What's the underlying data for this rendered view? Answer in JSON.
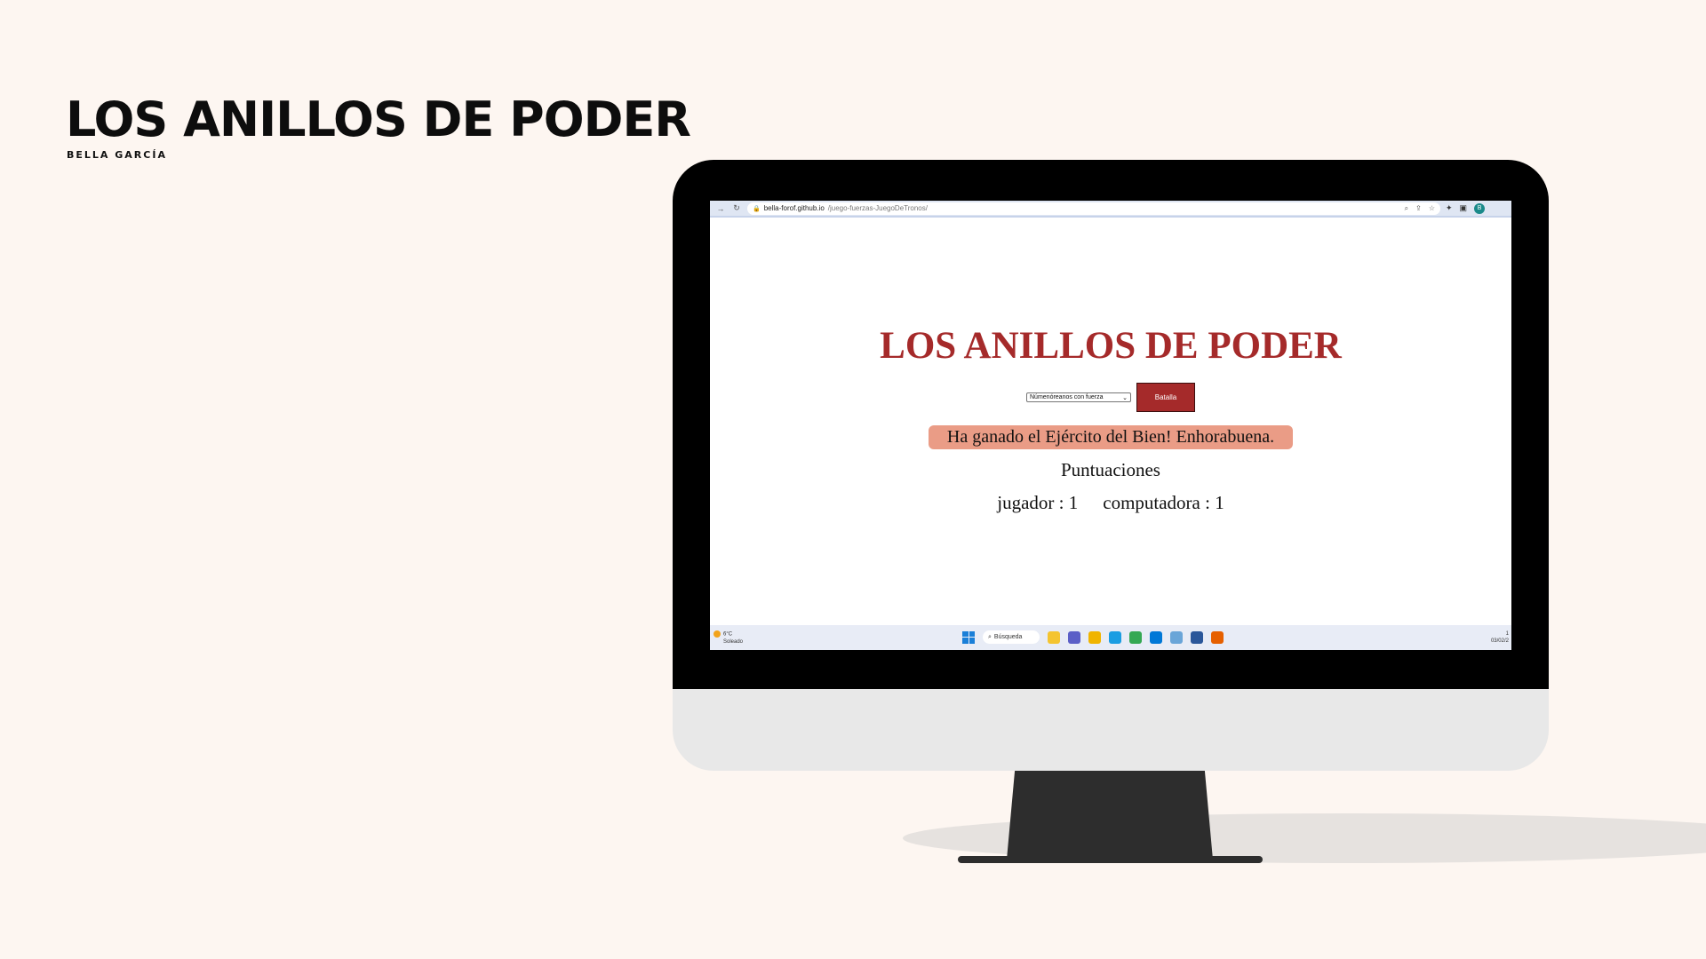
{
  "slide": {
    "title": "LOS ANILLOS DE PODER",
    "author": "BELLA GARCÍA"
  },
  "browser": {
    "url_domain": "bella-forof.github.io",
    "url_path": "/juego-fuerzas-JuegoDeTronos/",
    "profile_initial": "B"
  },
  "game": {
    "title": "LOS ANILLOS DE PODER",
    "select_value": "Númenóreanos con fuerza",
    "battle_label": "Batalla",
    "result": "Ha ganado el Ejército del Bien! Enhorabuena.",
    "scores_heading": "Puntuaciones",
    "player_score": "jugador : 1",
    "computer_score": "computadora : 1"
  },
  "taskbar": {
    "temperature": "6°C",
    "weather": "Soleado",
    "search_label": "Búsqueda",
    "clock_time": "1",
    "clock_date": "03/02/2",
    "apps": [
      {
        "name": "file-explorer-icon",
        "color": "#f4c430"
      },
      {
        "name": "teams-icon",
        "color": "#5b5fc7"
      },
      {
        "name": "folder-icon",
        "color": "#f0b400"
      },
      {
        "name": "edge-icon",
        "color": "#1b9de2"
      },
      {
        "name": "chrome-icon",
        "color": "#34a853"
      },
      {
        "name": "vscode-icon",
        "color": "#0078d7"
      },
      {
        "name": "notepad-icon",
        "color": "#6aa5d8"
      },
      {
        "name": "word-icon",
        "color": "#2b579a"
      },
      {
        "name": "firefox-icon",
        "color": "#e66000"
      }
    ]
  }
}
